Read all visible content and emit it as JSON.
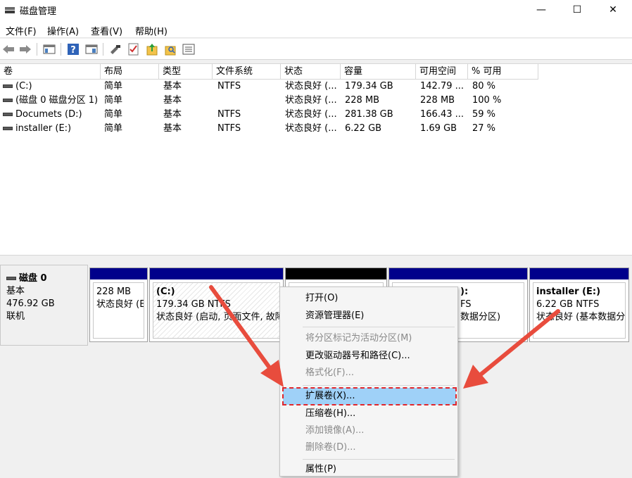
{
  "window": {
    "title": "磁盘管理",
    "min": "—",
    "max": "☐",
    "close": "✕"
  },
  "menu": [
    "文件(F)",
    "操作(A)",
    "查看(V)",
    "帮助(H)"
  ],
  "columns": [
    "卷",
    "布局",
    "类型",
    "文件系统",
    "状态",
    "容量",
    "可用空间",
    "% 可用"
  ],
  "rows": [
    [
      "(C:)",
      "简单",
      "基本",
      "NTFS",
      "状态良好 (...",
      "179.34 GB",
      "142.79 ...",
      "80 %"
    ],
    [
      "(磁盘 0 磁盘分区 1)",
      "简单",
      "基本",
      "",
      "状态良好 (...",
      "228 MB",
      "228 MB",
      "100 %"
    ],
    [
      "Documets (D:)",
      "简单",
      "基本",
      "NTFS",
      "状态良好 (...",
      "281.38 GB",
      "166.43 ...",
      "59 %"
    ],
    [
      "installer (E:)",
      "简单",
      "基本",
      "NTFS",
      "状态良好 (...",
      "6.22 GB",
      "1.69 GB",
      "27 %"
    ]
  ],
  "disk": {
    "name": "磁盘 0",
    "type": "基本",
    "size": "476.92 GB",
    "status": "联机"
  },
  "partitions": [
    {
      "line1": "",
      "line2": "228 MB",
      "line3": "状态良好 (E"
    },
    {
      "line1": "(C:)",
      "line2": "179.34 GB NTFS",
      "line3": "状态良好 (启动, 页面文件, 故障"
    },
    {
      "line1": "",
      "line2": "",
      "line3": ""
    },
    {
      "line1": "):",
      "line2": "FS",
      "line3": "数据分区)"
    },
    {
      "line1": "installer  (E:)",
      "line2": "6.22 GB NTFS",
      "line3": "状态良好 (基本数据分"
    }
  ],
  "context_menu": {
    "open": "打开(O)",
    "explorer": "资源管理器(E)",
    "mark_active": "将分区标记为活动分区(M)",
    "change_letter": "更改驱动器号和路径(C)...",
    "format": "格式化(F)...",
    "extend": "扩展卷(X)...",
    "shrink": "压缩卷(H)...",
    "add_mirror": "添加镜像(A)...",
    "delete": "删除卷(D)...",
    "properties": "属性(P)"
  },
  "colors": {
    "primary_partition_bar": "#00008b",
    "unallocated_bar": "#000000",
    "annotation_red": "#e84c3d",
    "highlight": "#9fd1f8"
  }
}
